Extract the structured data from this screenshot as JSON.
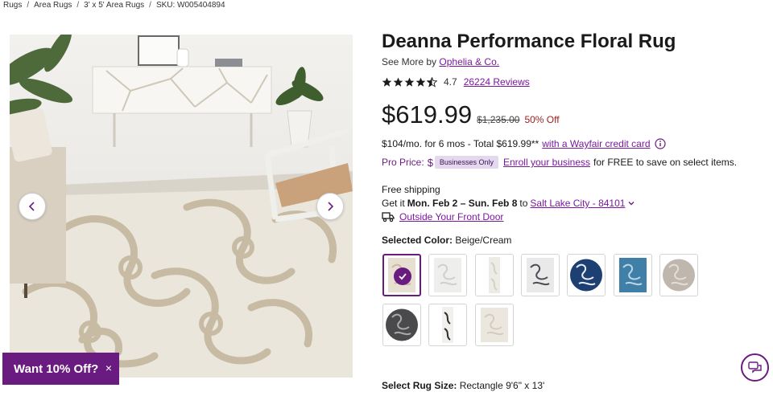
{
  "breadcrumb": {
    "items": [
      "Rugs",
      "Area Rugs",
      "3' x 5' Area Rugs"
    ],
    "sku": "SKU: W005404894"
  },
  "gallery": {
    "prev_icon": "chevron-left-icon",
    "next_icon": "chevron-right-icon"
  },
  "promo": {
    "label": "Want 10% Off?",
    "close": "×"
  },
  "product": {
    "title": "Deanna Performance Floral Rug",
    "see_more_prefix": "See More by",
    "brand": "Ophelia & Co.",
    "rating": "4.7",
    "rating_value": 4.5,
    "reviews": "26224 Reviews",
    "price": "$619.99",
    "old_price": "$1,235.00",
    "discount": "50% Off"
  },
  "financing": {
    "text": "$104/mo. for 6 mos - Total $619.99**",
    "link": "with a Wayfair credit card"
  },
  "pro": {
    "label": "Pro Price:",
    "dollar": "$",
    "badge": "Businesses Only",
    "link": "Enroll your business",
    "suffix": "for FREE to save on select items."
  },
  "shipping": {
    "free": "Free shipping",
    "get_it": "Get it",
    "dates": "Mon. Feb 2 – Sun. Feb 8",
    "to": "to",
    "location": "Salt Lake City - 84101",
    "delivery": "Outside Your Front Door"
  },
  "color": {
    "label": "Selected Color:",
    "value": "Beige/Cream",
    "swatches": [
      {
        "name": "beige-cream",
        "bg": "#e6dfd2",
        "fg": "#c9bba3",
        "shape": "rect"
      },
      {
        "name": "cream-white",
        "bg": "#eeeeec",
        "fg": "#cfcfcb",
        "shape": "rect"
      },
      {
        "name": "cream-runner",
        "bg": "#ecebe6",
        "fg": "#d5d1c6",
        "shape": "runner"
      },
      {
        "name": "grey-white",
        "bg": "#e9e9ea",
        "fg": "#4b4d55",
        "shape": "rect"
      },
      {
        "name": "navy-round",
        "bg": "#1e3f72",
        "fg": "#e9eef5",
        "shape": "round"
      },
      {
        "name": "blue",
        "bg": "#3f7fa8",
        "fg": "#bcd6e6",
        "shape": "rect"
      },
      {
        "name": "taupe-round",
        "bg": "#bfb6ad",
        "fg": "#e4ded6",
        "shape": "round"
      },
      {
        "name": "charcoal-round",
        "bg": "#4a4a4d",
        "fg": "#a9a9ab",
        "shape": "round"
      },
      {
        "name": "cream-black-runner",
        "bg": "#f2f0ec",
        "fg": "#2e2e2e",
        "shape": "runner"
      },
      {
        "name": "ivory",
        "bg": "#ebe7de",
        "fg": "#d4cdbf",
        "shape": "rect"
      }
    ]
  },
  "size": {
    "label": "Select Rug Size:",
    "value": "Rectangle 9'6\" x 13'"
  },
  "chat": {
    "icon": "chat-icon"
  },
  "colors": {
    "accent": "#7b189f",
    "brand": "#6a1b7f",
    "discount": "#9b1c1c"
  }
}
